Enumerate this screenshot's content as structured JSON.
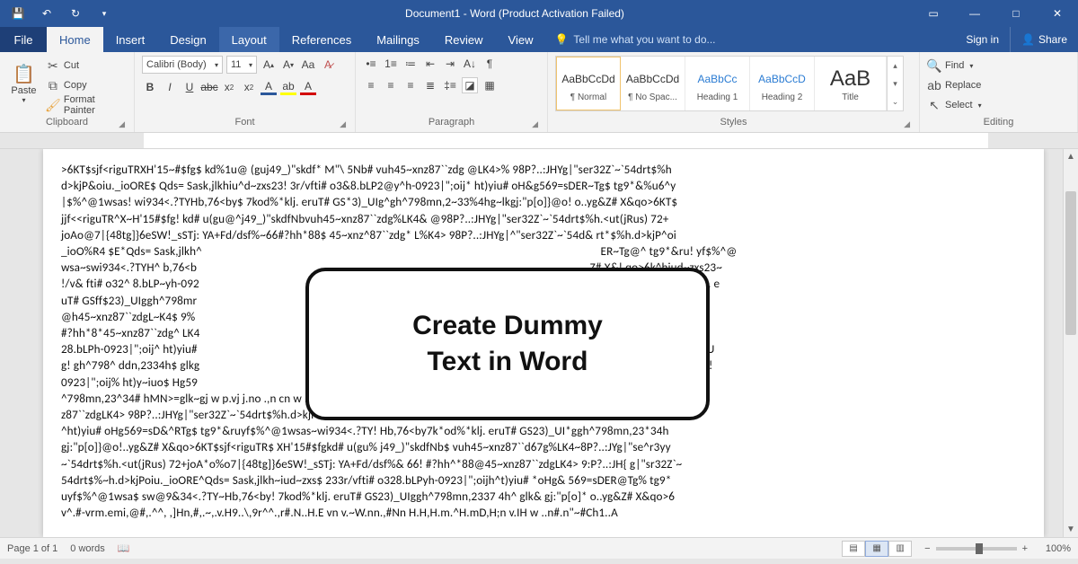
{
  "title": "Document1 - Word (Product Activation Failed)",
  "tabs": {
    "file": "File",
    "items": [
      "Home",
      "Insert",
      "Design",
      "Layout",
      "References",
      "Mailings",
      "Review",
      "View"
    ],
    "active_index": 0,
    "tellme_placeholder": "Tell me what you want to do...",
    "signin": "Sign in",
    "share": "Share"
  },
  "ribbon": {
    "clipboard": {
      "label": "Clipboard",
      "paste": "Paste",
      "cut": "Cut",
      "copy": "Copy",
      "format_painter": "Format Painter"
    },
    "font": {
      "label": "Font",
      "name": "Calibri (Body)",
      "size": "11"
    },
    "paragraph": {
      "label": "Paragraph"
    },
    "styles": {
      "label": "Styles",
      "items": [
        {
          "preview": "AaBbCcDd",
          "name": "¶ Normal",
          "class": ""
        },
        {
          "preview": "AaBbCcDd",
          "name": "¶ No Spac...",
          "class": ""
        },
        {
          "preview": "AaBbCc",
          "name": "Heading 1",
          "class": "blue"
        },
        {
          "preview": "AaBbCcD",
          "name": "Heading 2",
          "class": "blue"
        },
        {
          "preview": "AaB",
          "name": "Title",
          "class": "big"
        }
      ]
    },
    "editing": {
      "label": "Editing",
      "find": "Find",
      "replace": "Replace",
      "select": "Select"
    }
  },
  "document": {
    "lines": [
      ">6KT$sjf<riguTRXH'15~#$fg$ kd%1u@ (guj49_)\"skdf* M\"\\ 5Nb# vuh45~xnz87``zdg @LK4>% 98P?..:JHYg|\"ser32Z`~`54drt$%h",
      "d>kjP&oiu._ioORE$ Qds= Sask,jlkhiu^d~zxs23! 3r/vfti# o3&8.bLP2@y^h-0923|\";oij* ht)yiu# oH&g569=sDER~Tg$ tg9*&%u6^y",
      "|$%^@1wsas! wi934<.?TYHb,76<by$ 7kod%*klj. eruT# GS*3)_UIg^gh^798mn,2~33%4hg~lkgj:\"p[o]}@o! o..yg&Z# X&qo>6KT$",
      "jjf<<riguTR^X~H'15#$fg! kd# u(gu@^j49_)\"skdfNbvuh45~xnz87``zdg%LK4& @98P?..:JHYg|\"ser32Z`~`54drt$%h.<ut(jRus) 72+",
      "joAo@7|{48tg]}6eSW!_sSTj: YA+Fd/dsf%~66#?hh*88$ 45~xnz^87``zdg* L%K4> 98P?..:JHYg|^\"ser32Z`~`54d& rt*$%h.d>kjP^oi",
      "_ioO%R4 $E*Qds= Sask,jlkh^                                                                                                                                                ER~Tg@^ tg9*&ru! yf$%^@",
      "wsa~swi934<.?TYH^ b,76<b                                                                                                                                              Z# X&! qo>6k^hiud~zxs23~",
      "!/v& fti# o32^ 8.bLP~yh-092                                                                                                                                         <.?TYHb,76<by7ko! d%*klj. e",
      "uT# GSff$23)_UIggh^798mr                                                                                                                                        d# u(guj49_)\"skd% fN$ bv^",
      "@h45~xnz87``zdgL~K4$ 9%                                                                                                                                      .6eSW!_s! STj: YA+F! d/dsf%6",
      "#?hh*8*45~xnz87``zdg^ LK4                                                                                                                                     jlkh$ iud~zx^ s233r/vfti# o!",
      "28.bLPh-0923|\";oij^ ht)yiu#                                                                                                                                        7ko^ %*klj. eruT# GS2h 3)_U",
      "g! gh^798^ ddn,2334h$ glkg                                                                                                                                       ~zxs23! 3r/vft@io$ 328.bLP!",
      "0923|\";oij% ht)y~iuo$ Hg59                                                                                                                                        .J~d%*klj. (eruT^G! S23)_UI",
      "^798mn,23^34# hMN>=glk~gj w p.vj j.no .,n cn w .u u.nvr j v .jj.±nn, vorn vn ur n jv..j\"skdfM\"\\ 5Nb# vuh45",
      "z87``zdgLK4> 98P?..:JHYg|\"ser32Z`~`54drt$%h.d>kjPo*iu._ioOR~E$ Qds= Sask,jlkhiud~zxs`23~3r/vfti# o3&8.bL$ Pyh-0923|\";",
      "^ht)yiu# oHg569=sD&^RTg$ tg9*&ruyf$%^@1wsas~wi934<.?TY! Hb,76<by7k*od%*klj. eruT# GS23)_UI*ggh^798mn,23*34h",
      "gj:\"p[o]}@o!..yg&Z# X&qo>6KT$sjf<riguTR$ XH'15#$fgkd# u(gu% j49_)\"skdfNb$ vuh45~xnz87``d67g%LK4~8P?..:JYg|\"se^r3yy",
      "~`54drt$%h.<ut(jRus) 72+joA*o%o7|{48tg]}6eSW!_sSTj: YA+Fd/dsf%& 66! #?hh^*88@45~xnz87``zdgLK4> 9:P?..:JH{ g|\"sr32Z`~",
      "54drt$%~h.d>kjPoiu._ioORE^Qds= Sask,jlkh~iud~zxs$ 233r/vfti# o328.bLPyh-0923|\";oijh^t)yiu# *oHg& 569=sDER@Tg% tg9*",
      "uyf$%^@1wsa$ sw@9&34<.?TY~Hb,76<by! 7kod%*klj. eruT# GS23)_UIggh^798mn,2337 4h^ glk& gj:\"p[o]* o..yg&Z# X&qo>6",
      "v^.#-vrm.emi,@#,.^^, ,]Hn,#,.~,.v.H9..\\,9r^^.,r#.N..H.E vn v.~W.nn.,#Nn H.H,H.m.^H.mD,H;n v.IH w ..n#.n\"~#Ch1..A"
    ]
  },
  "callout": {
    "line1": "Create Dummy",
    "line2": "Text in Word"
  },
  "status": {
    "page": "Page 1 of 1",
    "words": "0 words",
    "zoom": "100%"
  }
}
